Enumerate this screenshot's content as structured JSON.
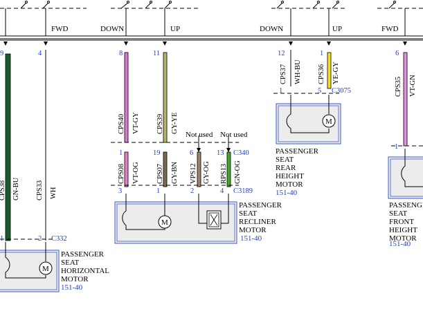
{
  "diagram": {
    "switch_labels": {
      "fwd_left": "FWD",
      "down_1": "DOWN",
      "up_1": "UP",
      "down_2": "DOWN",
      "up_2": "UP",
      "fwd_right": "FWD"
    },
    "pins": {
      "p9": "9",
      "p4": "4",
      "p8": "8",
      "p11": "11",
      "p12": "12",
      "p1a": "1",
      "p6r": "6",
      "p1b": "1",
      "p5": "5",
      "p1c": "1",
      "p19": "19",
      "p6": "6",
      "p13": "13",
      "p3": "3",
      "p1d": "1",
      "p2a": "2",
      "p4b": "4",
      "p1e": "1",
      "p2b": "2",
      "p1f": "1"
    },
    "connectors": {
      "c3075": "C3075",
      "c340": "C340",
      "c3189": "C3189",
      "c332": "C332"
    },
    "circuits": {
      "cps38": "CPS38",
      "gn_bu": "GN-BU",
      "cps33": "CPS33",
      "wh": "WH",
      "cps40": "CPS40",
      "vt_gy": "VT-GY",
      "cps39": "CPS39",
      "gy_ye": "GY-YE",
      "cps08": "CPS08",
      "vt_og": "VT-OG",
      "cps07": "CPS07",
      "gy_bn": "GY-BN",
      "vps12": "VPS12",
      "gy_og": "GY-OG",
      "rps13": "RPS13",
      "gn_og": "GN-OG",
      "cps37": "CPS37",
      "wh_bu": "WH-BU",
      "cps36": "CPS36",
      "ye_gy": "YE-GY",
      "cps35": "CPS35",
      "vt_gn": "VT-GN"
    },
    "not_used_1": "Not used",
    "not_used_2": "Not used",
    "components": {
      "rear_height": {
        "line1": "PASSENGER",
        "line2": "SEAT",
        "line3": "REAR",
        "line4": "HEIGHT",
        "line5": "MOTOR",
        "ref": "151-40"
      },
      "recliner": {
        "line1": "PASSENGER",
        "line2": "SEAT",
        "line3": "RECLINER",
        "line4": "MOTOR",
        "ref": "151-40"
      },
      "horizontal": {
        "line1": "PASSENGER",
        "line2": "SEAT",
        "line3": "HORIZONTAL",
        "line4": "MOTOR",
        "ref": "151-40"
      },
      "front_height": {
        "line1": "PASSENGER",
        "line2": "SEAT",
        "line3": "FRONT",
        "line4": "HEIGHT",
        "line5": "MOTOR",
        "ref": "151-40"
      }
    },
    "motor_symbol": "M",
    "colors": {
      "gn_bu": "#1a5c2a",
      "vt_gy": "#d47ad4",
      "gy_ye": "#b5b56a",
      "vt_og": "#e080c8",
      "gy_bn": "#7a6a50",
      "gy_og": "#a08070",
      "gn_og": "#3faa2a",
      "ye_gy": "#f0e020",
      "vt_gn": "#e090e0",
      "wh_bu": "#eeeeee",
      "component_fill": "#ececec",
      "component_border": "#3a55c8"
    }
  }
}
